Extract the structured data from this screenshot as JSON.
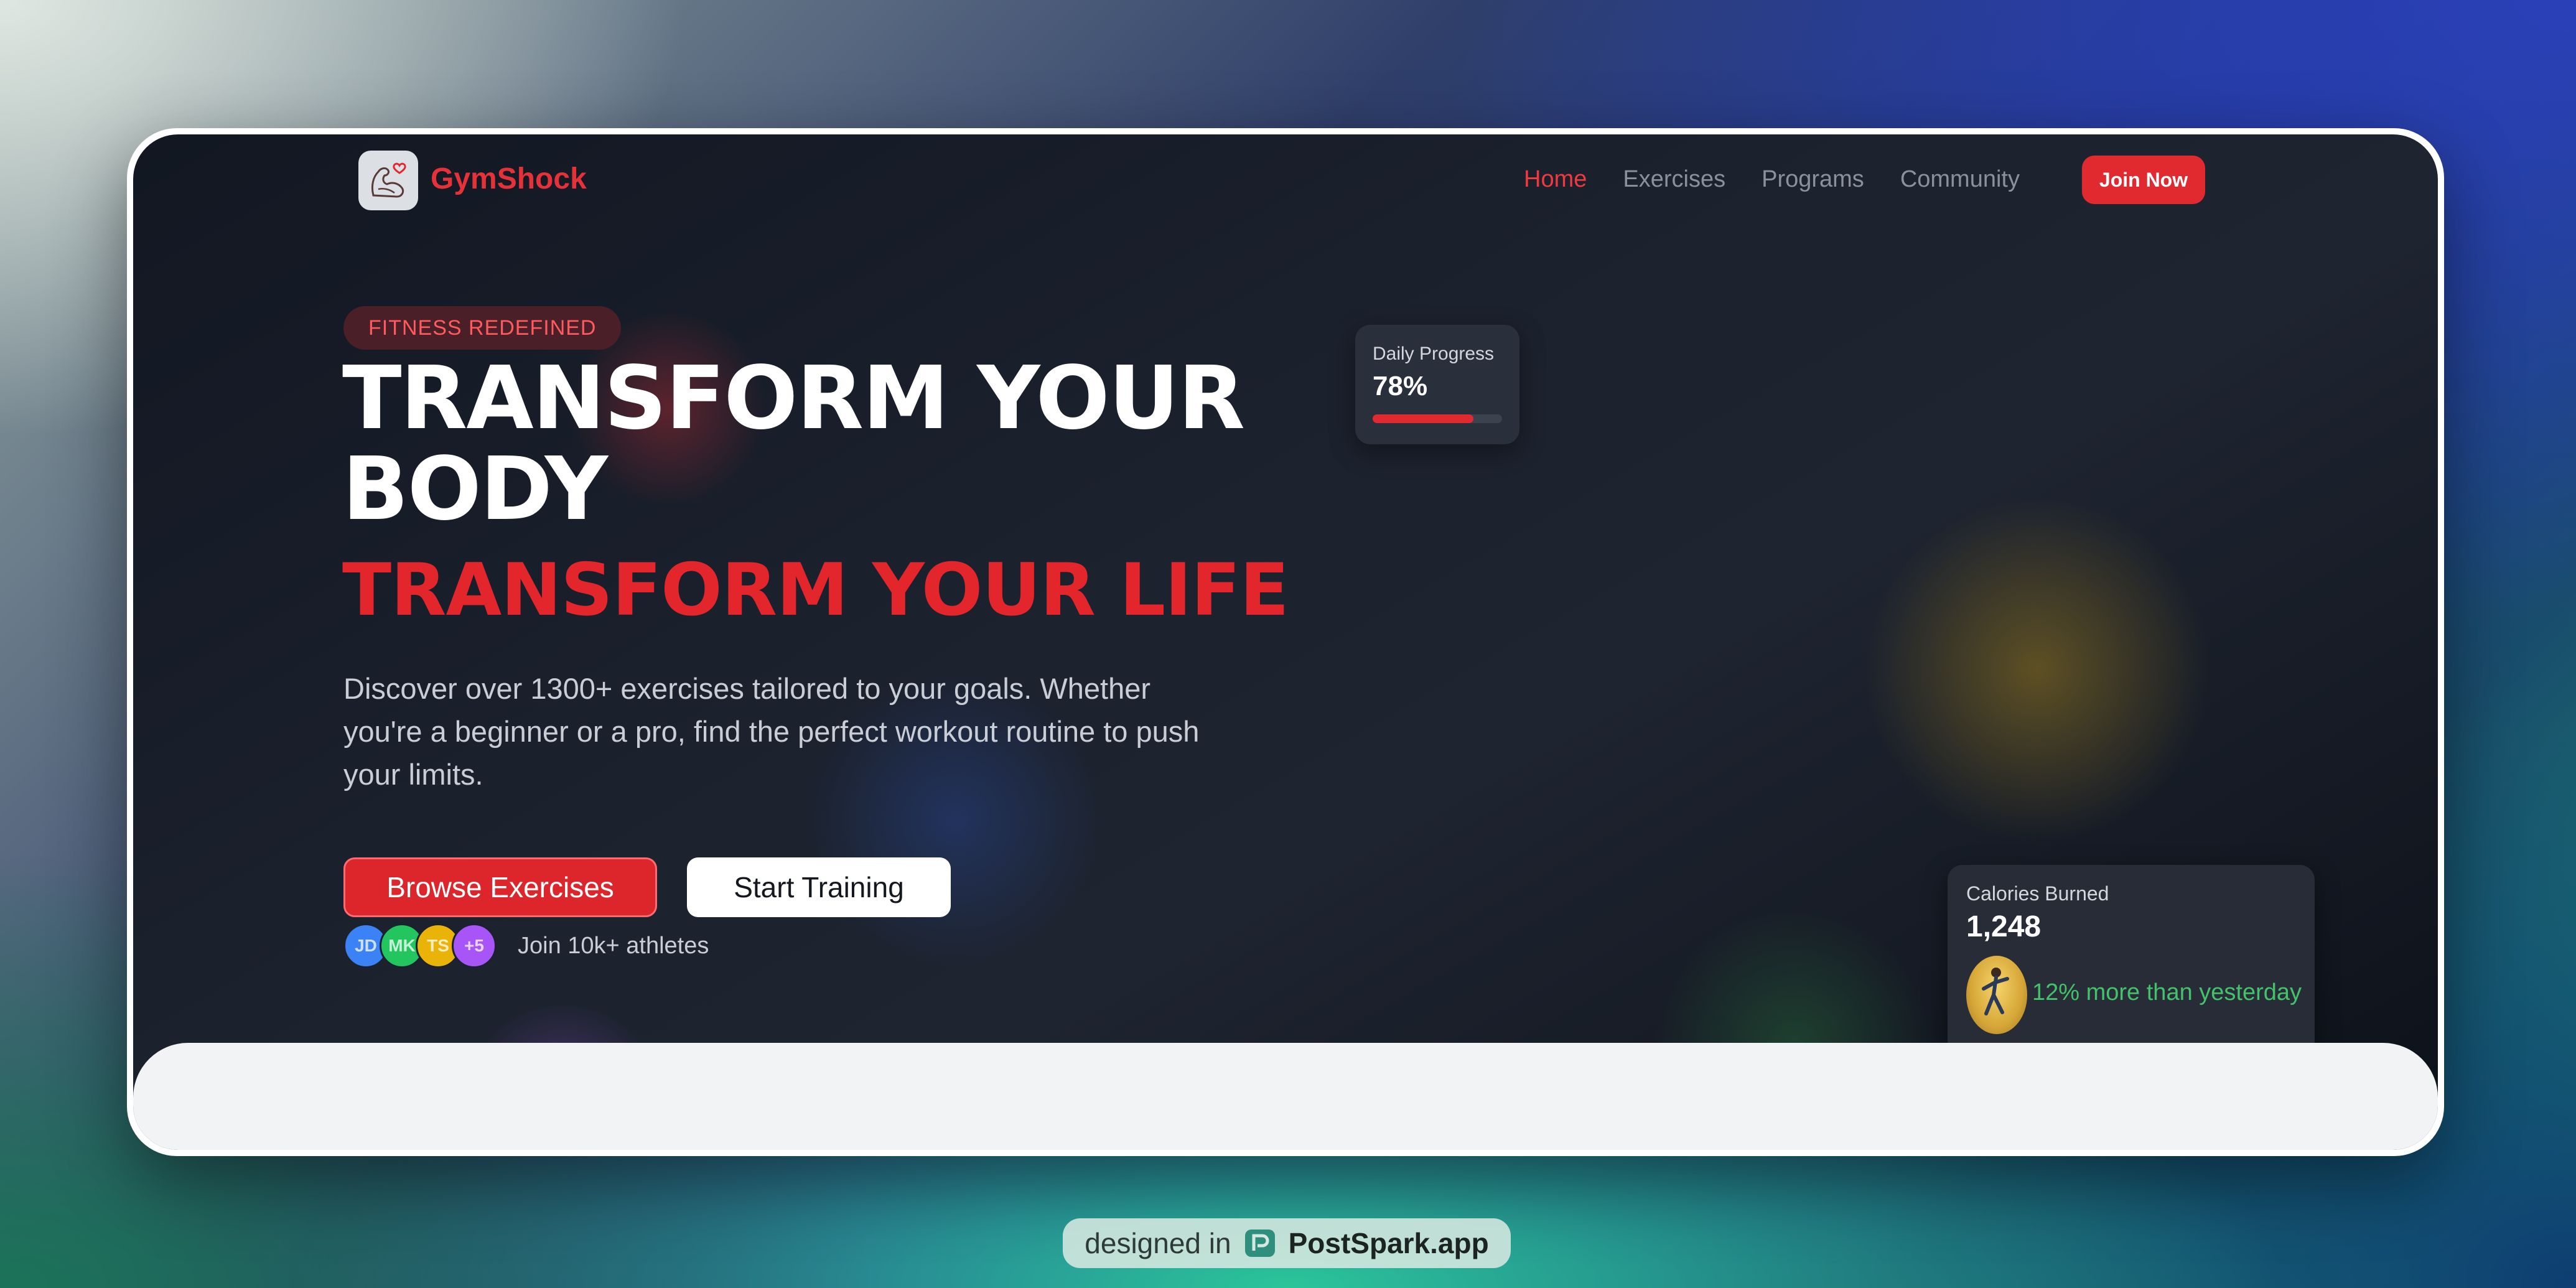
{
  "nav": {
    "brand": "GymShock",
    "links": [
      {
        "label": "Home",
        "active": true
      },
      {
        "label": "Exercises",
        "active": false
      },
      {
        "label": "Programs",
        "active": false
      },
      {
        "label": "Community",
        "active": false
      }
    ],
    "cta": "Join Now"
  },
  "hero": {
    "tagline": "FITNESS REDEFINED",
    "title": "TRANSFORM YOUR BODY",
    "title_accent": "TRANSFORM YOUR LIFE",
    "description": "Discover over 1300+ exercises tailored to your goals. Whether you're a beginner or a pro, find the perfect workout routine to push your limits.",
    "primary_button": "Browse Exercises",
    "secondary_button": "Start Training",
    "avatars": [
      {
        "initials": "JD",
        "color": "#3b82f6"
      },
      {
        "initials": "MK",
        "color": "#22c55e"
      },
      {
        "initials": "TS",
        "color": "#eab308"
      },
      {
        "initials": "+5",
        "color": "#a855f7"
      }
    ],
    "social_proof": "Join 10k+ athletes"
  },
  "stats": {
    "progress": {
      "label": "Daily Progress",
      "value": "78%",
      "percent": 78
    },
    "calories": {
      "label": "Calories Burned",
      "value": "1,248",
      "note": "12% more than yesterday"
    }
  },
  "watermark": {
    "prefix": "designed in",
    "brand": "PostSpark.app"
  },
  "colors": {
    "accent": "#e3262c",
    "success": "#43c26b",
    "background": "#1b212d"
  }
}
